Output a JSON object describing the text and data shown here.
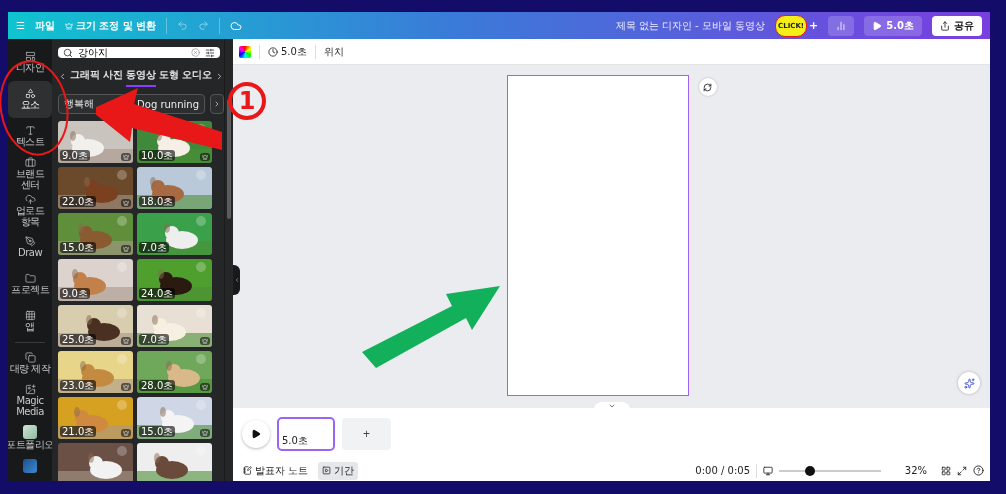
{
  "top_bar": {
    "menu": "☰",
    "file": "파일",
    "resize": "크기 조정 및 변환",
    "title": "제목 없는 디자인 - 모바일 동영상",
    "sticker": "CLICK!",
    "plus": "+",
    "play_duration": "5.0초",
    "share": "공유"
  },
  "rail": [
    {
      "label": "디자인",
      "selected": false
    },
    {
      "label": "요소",
      "selected": true
    },
    {
      "label": "텍스트",
      "selected": false
    },
    {
      "label": "브랜드 센터",
      "selected": false
    },
    {
      "label": "업로드 항목",
      "selected": false
    },
    {
      "label": "Draw",
      "selected": false
    },
    {
      "label": "프로젝트",
      "selected": false
    },
    {
      "label": "앱",
      "selected": false
    },
    {
      "label": "대량 제작",
      "selected": false
    },
    {
      "label": "Magic Media",
      "selected": false
    },
    {
      "label": "포트폴리오",
      "selected": false
    }
  ],
  "search": {
    "value": "강아지"
  },
  "tabs": [
    {
      "label": "그래픽",
      "selected": false
    },
    {
      "label": "사진",
      "selected": false
    },
    {
      "label": "동영상",
      "selected": true
    },
    {
      "label": "도형",
      "selected": false
    },
    {
      "label": "오디오",
      "selected": false
    }
  ],
  "chips": [
    "행복해",
    "Dog running"
  ],
  "videos": [
    {
      "duration": "9.0초",
      "premium": true
    },
    {
      "duration": "10.0초",
      "premium": true
    },
    {
      "duration": "22.0초",
      "premium": true
    },
    {
      "duration": "18.0초",
      "premium": false
    },
    {
      "duration": "15.0초",
      "premium": true
    },
    {
      "duration": "7.0초",
      "premium": false
    },
    {
      "duration": "9.0초",
      "premium": false
    },
    {
      "duration": "24.0초",
      "premium": false
    },
    {
      "duration": "25.0초",
      "premium": true
    },
    {
      "duration": "7.0초",
      "premium": true
    },
    {
      "duration": "23.0초",
      "premium": true
    },
    {
      "duration": "28.0초",
      "premium": true
    },
    {
      "duration": "21.0초",
      "premium": true
    },
    {
      "duration": "15.0초",
      "premium": true
    },
    {
      "premium": false
    },
    {
      "premium": false
    }
  ],
  "toolbar": {
    "duration": "5.0초",
    "position": "위치"
  },
  "timeline": {
    "clip": "5.0초",
    "add": "+"
  },
  "bottom_bar": {
    "notes": "발표자 노트",
    "duration": {
      "label": "기간",
      "selected": true
    },
    "time": "0:00 / 0:05",
    "zoom": {
      "level": 0.3
    },
    "zoom_reading": "32%"
  },
  "annotation": {
    "number": "1"
  }
}
